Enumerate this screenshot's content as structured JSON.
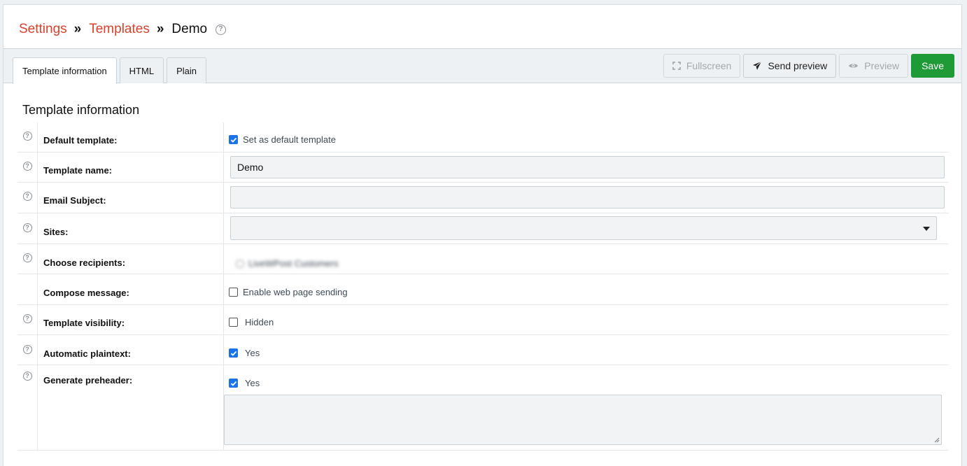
{
  "breadcrumb": {
    "settings": "Settings",
    "templates": "Templates",
    "current": "Demo",
    "separator": "»",
    "help_symbol": "?"
  },
  "tabs": [
    {
      "label": "Template information",
      "active": true
    },
    {
      "label": "HTML",
      "active": false
    },
    {
      "label": "Plain",
      "active": false
    }
  ],
  "actions": {
    "fullscreen": "Fullscreen",
    "send_preview": "Send preview",
    "preview": "Preview",
    "save": "Save"
  },
  "colors": {
    "link": "#d9412d",
    "save": "#1e9a36",
    "checkbox": "#1a73e8"
  },
  "section_title": "Template information",
  "form": {
    "default_template": {
      "label": "Default template:",
      "option": "Set as default template",
      "checked": true
    },
    "template_name": {
      "label": "Template name:",
      "value": "Demo"
    },
    "email_subject": {
      "label": "Email Subject:",
      "value": ""
    },
    "sites": {
      "label": "Sites:",
      "value": ""
    },
    "choose_recipients": {
      "label": "Choose recipients:",
      "option": "LiveWPost Customers"
    },
    "compose_message": {
      "label": "Compose message:",
      "option": "Enable web page sending",
      "checked": false
    },
    "template_visibility": {
      "label": "Template visibility:",
      "option": "Hidden",
      "checked": false
    },
    "automatic_plaintext": {
      "label": "Automatic plaintext:",
      "option": "Yes",
      "checked": true
    },
    "generate_preheader": {
      "label": "Generate preheader:",
      "option": "Yes",
      "checked": true,
      "value": ""
    }
  }
}
